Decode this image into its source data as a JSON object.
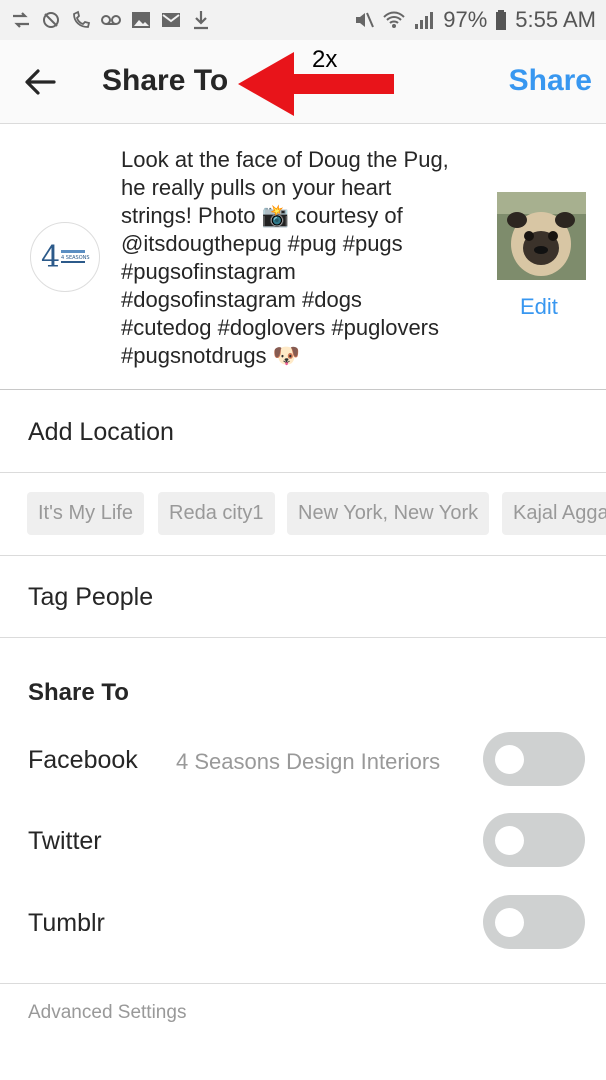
{
  "status_bar": {
    "left_icons": [
      "sync-icon",
      "no-sim-icon",
      "missed-call-icon",
      "voicemail-icon",
      "image-icon",
      "mail-icon",
      "download-icon"
    ],
    "right_icons": [
      "mute-icon",
      "wifi-icon",
      "signal-icon",
      "battery-icon"
    ],
    "battery": "97%",
    "time": "5:55 AM"
  },
  "header": {
    "title": "Share To",
    "action": "Share",
    "annotation": "2x",
    "accent_color": "#3897f0"
  },
  "post": {
    "caption": "Look at the face of Doug the Pug,\nhe really pulls on your heart\nstrings! Photo 📸 courtesy of\n@itsdougthepug #pug #pugs\n#pugsofinstagram\n#dogsofinstagram #dogs\n#cutedog #doglovers #puglovers\n#pugsnotdrugs 🐶",
    "edit_label": "Edit",
    "avatar_logo_text": "4 SEASONS"
  },
  "location": {
    "label": "Add Location",
    "suggestions": [
      "It's My Life",
      "Reda city1",
      "New York, New York",
      "Kajal Agga"
    ]
  },
  "tag_people": {
    "label": "Tag People"
  },
  "share_to": {
    "heading": "Share To",
    "networks": [
      {
        "name": "Facebook",
        "account": "4 Seasons Design Interiors",
        "enabled": false
      },
      {
        "name": "Twitter",
        "account": "",
        "enabled": false
      },
      {
        "name": "Tumblr",
        "account": "",
        "enabled": false
      }
    ]
  },
  "advanced_settings": {
    "label": "Advanced Settings"
  }
}
